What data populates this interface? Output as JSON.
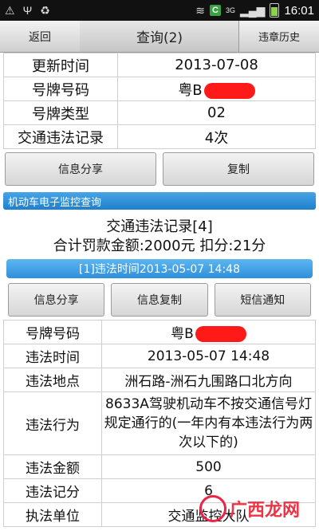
{
  "status_bar": {
    "time": "16:01",
    "network": "3G"
  },
  "nav": {
    "back": "返回",
    "title": "查询(2)",
    "history": "违章历史"
  },
  "info_rows": [
    {
      "label": "更新时间",
      "value": "2013-07-08"
    },
    {
      "label": "号牌号码",
      "value": "粤B"
    },
    {
      "label": "号牌类型",
      "value": "02"
    },
    {
      "label": "交通违法记录",
      "value": "4次"
    }
  ],
  "buttons_top": {
    "share": "信息分享",
    "copy": "复制"
  },
  "section_title": "机动车电子监控查询",
  "summary": {
    "line1": "交通违法记录[4]",
    "line2": "合计罚款金额:2000元 扣分:21分"
  },
  "violation_header": "[1]违法时间2013-05-07 14:48",
  "buttons_detail": {
    "share": "信息分享",
    "copy": "信息复制",
    "sms": "短信通知"
  },
  "detail_rows": [
    {
      "label": "号牌号码",
      "value": "粤B"
    },
    {
      "label": "违法时间",
      "value": "2013-05-07 14:48"
    },
    {
      "label": "违法地点",
      "value": "洲石路-洲石九围路口北方向"
    },
    {
      "label": "违法行为",
      "value": "8633A驾驶机动车不按交通信号灯规定通行的(一年内有本违法行为两次以下的)"
    },
    {
      "label": "违法金额",
      "value": "500"
    },
    {
      "label": "违法记分",
      "value": "6"
    },
    {
      "label": "执法单位",
      "value": "交通监控大队"
    }
  ],
  "watermark": "广西龙网"
}
